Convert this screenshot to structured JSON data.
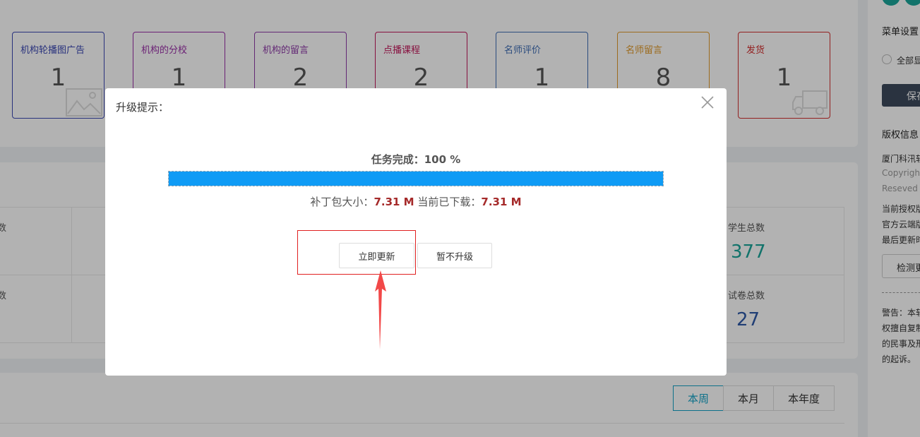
{
  "stat_cards": [
    {
      "title": "机构轮播图广告",
      "count": "1",
      "color": "#3a47b3"
    },
    {
      "title": "机构的分校",
      "count": "1",
      "color": "#9a2fa8"
    },
    {
      "title": "机构的留言",
      "count": "2",
      "color": "#8e3aa8"
    },
    {
      "title": "点播课程",
      "count": "2",
      "color": "#c2185b"
    },
    {
      "title": "名师评价",
      "count": "1",
      "color": "#3f6eb5"
    },
    {
      "title": "名师留言",
      "count": "8",
      "color": "#e09a2b"
    },
    {
      "title": "发货",
      "count": "1",
      "color": "#d32f2f"
    }
  ],
  "grid": {
    "left_label_1": "数",
    "left_label_2": "数",
    "students_label": "学生总数",
    "students_value": "377",
    "students_color": "#1aa59a",
    "papers_label": "试卷总数",
    "papers_value": "27",
    "papers_color": "#2f5aa8"
  },
  "tabs": [
    {
      "label": "本周",
      "active": true
    },
    {
      "label": "本月",
      "active": false
    },
    {
      "label": "本年度",
      "active": false
    }
  ],
  "sidebar": {
    "menu_settings": "菜单设置",
    "show_all": "全部显",
    "save": "保存",
    "copyright_title": "版权信息",
    "company": "厦门科汛软",
    "copyright_line1": "Copyright",
    "copyright_line2": "Reseved",
    "license_line1": "当前授权版",
    "license_line2": "官方云端版",
    "license_line3": "最后更新时",
    "check_update": "检测更",
    "warning_line1": "警告：本软",
    "warning_line2": "权擅自复制",
    "warning_line3": "的民事及刑",
    "warning_line4": "的起诉。"
  },
  "modal": {
    "title": "升级提示：",
    "task_label": "任务完成：",
    "task_value": "100 %",
    "progress_fraction": 1.0,
    "patch_size_label": "补丁包大小：",
    "patch_size_value": "7.31 M",
    "downloaded_label": "当前已下载：",
    "downloaded_value": "7.31 M",
    "update_button": "立即更新",
    "skip_button": "暂不升级"
  }
}
